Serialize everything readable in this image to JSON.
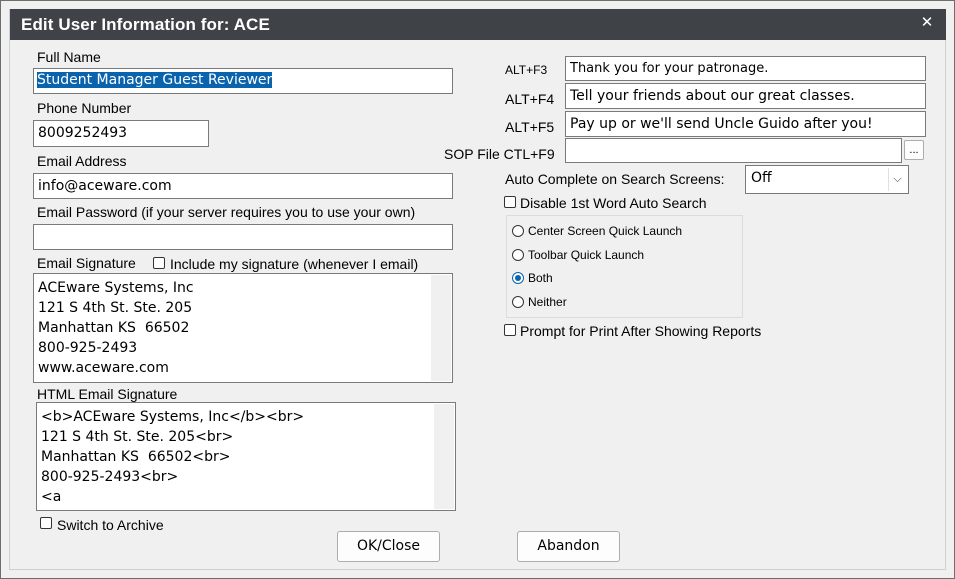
{
  "dialog": {
    "title": "Edit User Information for: ACE",
    "close_glyph": "✕"
  },
  "left": {
    "full_name": {
      "label": "Full Name",
      "value": "Student Manager Guest Reviewer"
    },
    "phone": {
      "label": "Phone Number",
      "value": "8009252493"
    },
    "email": {
      "label": "Email Address",
      "value": "info@aceware.com"
    },
    "email_password": {
      "label": "Email Password (if your server requires you to use your own)",
      "value": ""
    },
    "signature": {
      "label": "Email Signature",
      "include_label": "Include my signature (whenever I email)",
      "include_checked": false,
      "lines": [
        "ACEware Systems, Inc",
        "121 S 4th St. Ste. 205",
        "Manhattan KS  66502",
        "800-925-2493",
        "www.aceware.com"
      ]
    },
    "html_signature": {
      "label": "HTML Email Signature",
      "lines": [
        "<b>ACEware Systems, Inc</b><br>",
        "121 S 4th St. Ste. 205<br>",
        "Manhattan KS  66502<br>",
        "800-925-2493<br>",
        "<a"
      ]
    },
    "archive": {
      "label": "Switch to Archive",
      "checked": false
    }
  },
  "right": {
    "hotkeys": [
      {
        "label": "ALT+F3",
        "value": "Thank you for your patronage."
      },
      {
        "label": "ALT+F4",
        "value": "Tell your friends about our great classes."
      },
      {
        "label": "ALT+F5",
        "value": "Pay up or we'll send Uncle Guido after you!"
      }
    ],
    "sop_file": {
      "label": "SOP File CTL+F9",
      "value": "",
      "browse_label": "..."
    },
    "auto_complete": {
      "label": "Auto Complete on Search Screens:",
      "selected": "Off"
    },
    "disable_first_word": {
      "label": "Disable 1st Word Auto Search",
      "checked": false
    },
    "quick_launch": {
      "options": [
        {
          "label": "Center Screen Quick Launch",
          "checked": false
        },
        {
          "label": "Toolbar Quick Launch",
          "checked": false
        },
        {
          "label": "Both",
          "checked": true
        },
        {
          "label": "Neither",
          "checked": false
        }
      ]
    },
    "prompt_print": {
      "label": "Prompt for Print After Showing Reports",
      "checked": false
    }
  },
  "buttons": {
    "ok_label": "OK/Close",
    "abandon_label": "Abandon"
  },
  "colors": {
    "titlebar": "#3f4347",
    "selection": "#0a64ad",
    "radio_checked": "#0a64ad"
  },
  "icons": {
    "close": "close-icon",
    "dropdown": "chevron-down-icon"
  }
}
